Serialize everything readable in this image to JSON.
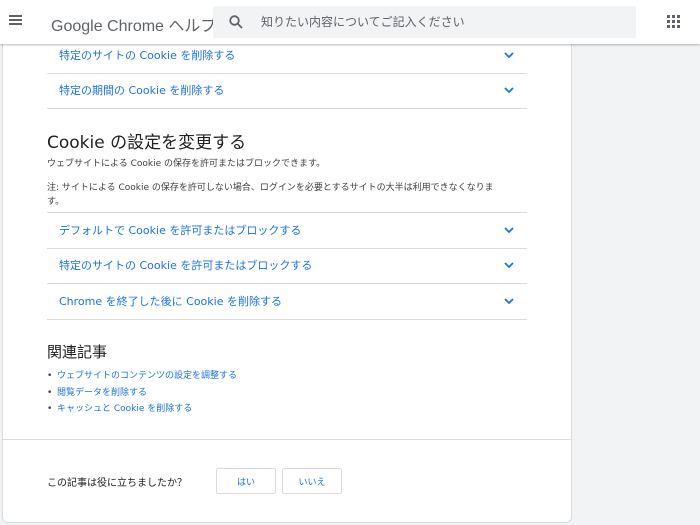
{
  "header": {
    "title": "Google Chrome ヘルプ",
    "menu_icon": "menu-icon",
    "apps_icon": "apps-grid-icon",
    "search": {
      "icon": "search-icon",
      "placeholder": "知りたい内容についてご記入ください",
      "value": ""
    }
  },
  "colors": {
    "link": "#1a73e8",
    "divider": "#dadce0",
    "page_background": "#f1f3f4"
  },
  "article": {
    "top_rows": [
      {
        "label": "特定のサイトの Cookie を削除する",
        "icon": "chevron-down-icon"
      },
      {
        "label": "特定の期間の Cookie を削除する",
        "icon": "chevron-down-icon"
      }
    ],
    "section": {
      "heading": "Cookie の設定を変更する",
      "intro": "ウェブサイトによる Cookie の保存を許可またはブロックできます。",
      "note_line1": "注: サイトによる Cookie の保存を許可しない場合、ログインを必要とするサイトの大半は利用できなくなりま",
      "note_line2": "す。",
      "rows": [
        {
          "label": "デフォルトで Cookie を許可またはブロックする",
          "icon": "chevron-down-icon"
        },
        {
          "label": "特定のサイトの Cookie を許可またはブロックする",
          "icon": "chevron-down-icon"
        },
        {
          "label": "Chrome を終了した後に Cookie を削除する",
          "icon": "chevron-down-icon"
        }
      ]
    },
    "related": {
      "heading": "関連記事",
      "bullet": "•",
      "links": [
        "ウェブサイトのコンテンツの設定を調整する",
        "閲覧データを削除する",
        "キャッシュと Cookie を削除する"
      ]
    }
  },
  "feedback": {
    "question": "この記事は役に立ちましたか？",
    "yes_label": "はい",
    "no_label": "いいえ"
  }
}
